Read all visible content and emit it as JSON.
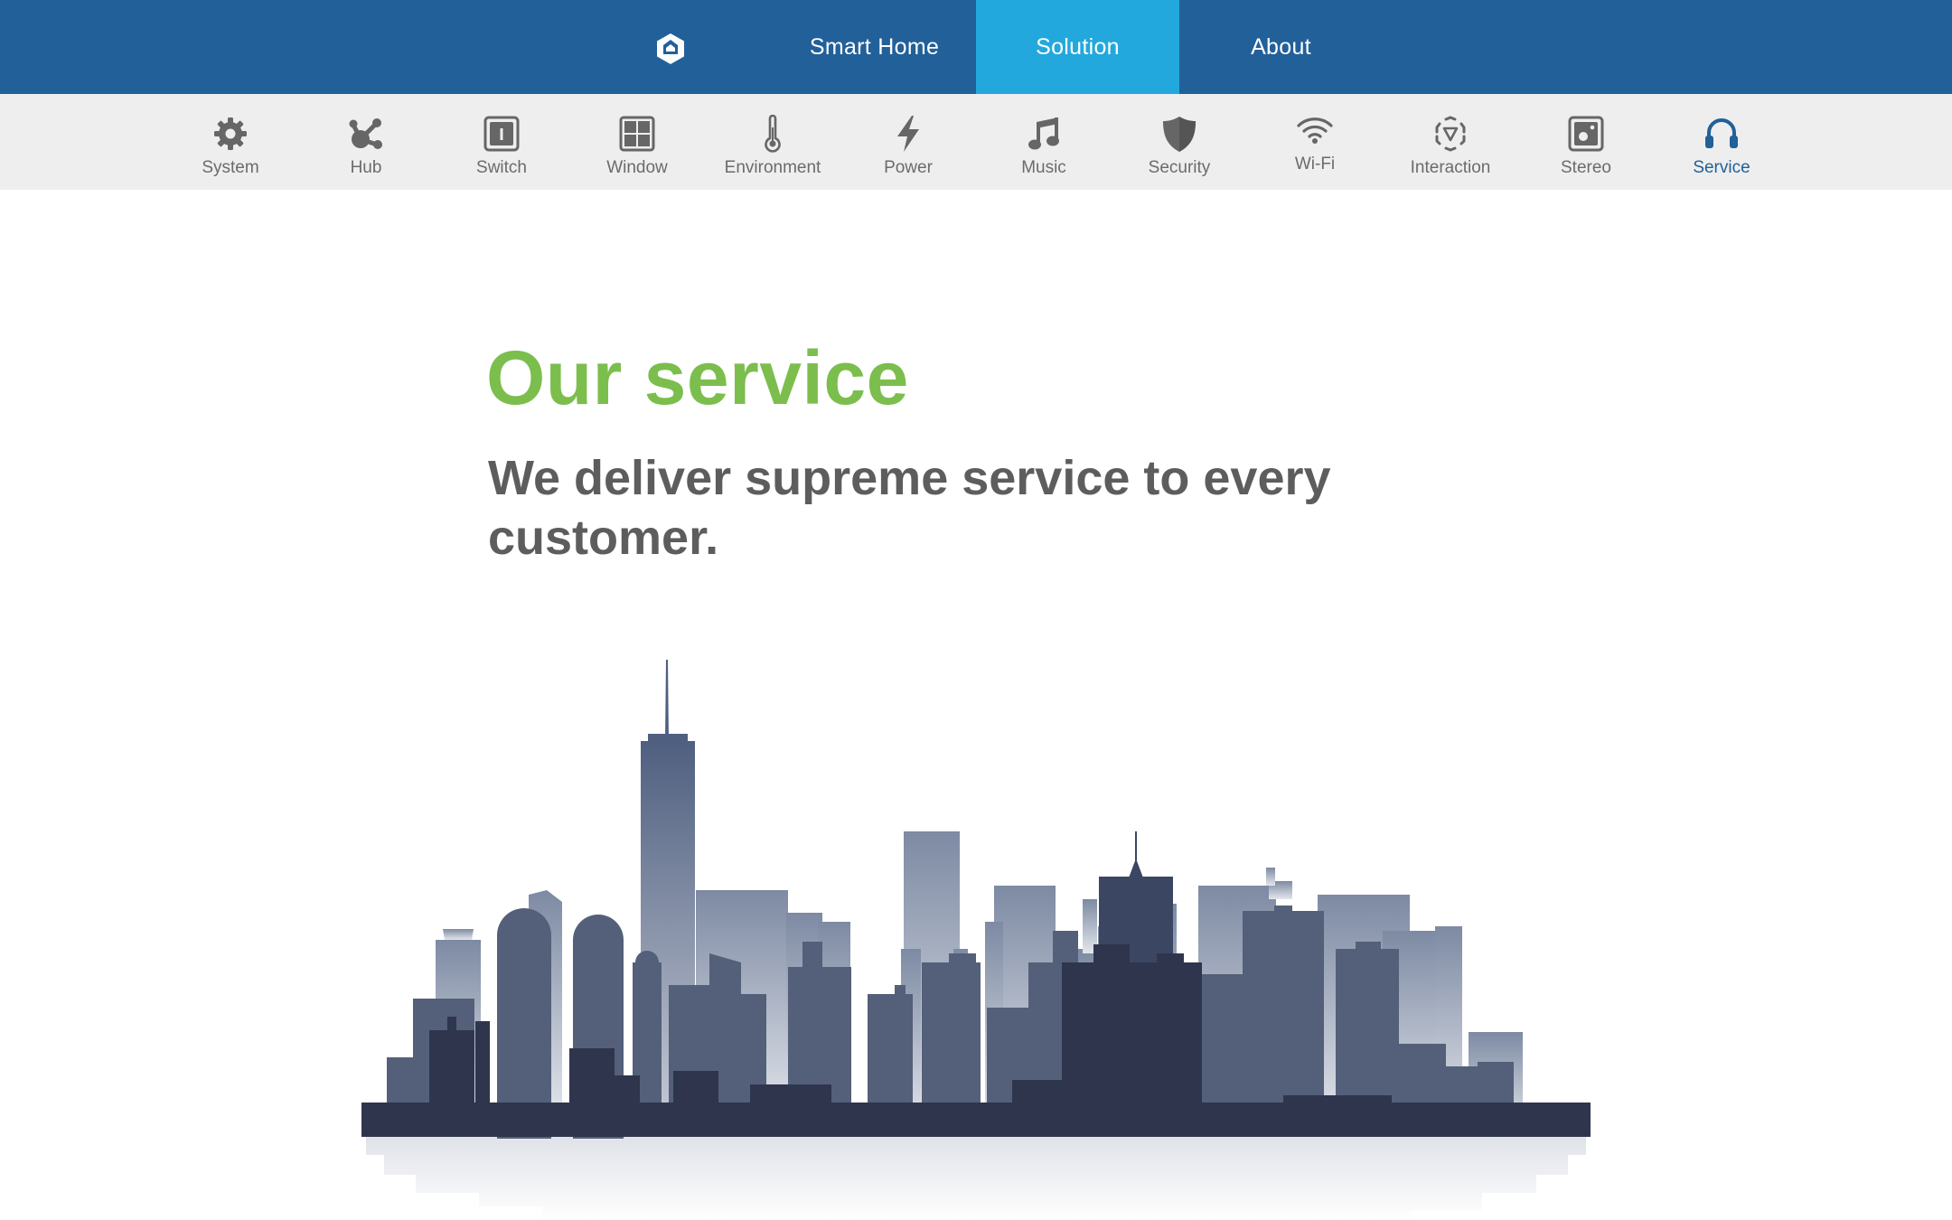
{
  "header": {
    "logo_icon": "hexagon-home-logo",
    "tabs": [
      {
        "label": "Smart Home",
        "active": false
      },
      {
        "label": "Solution",
        "active": true
      },
      {
        "label": "About",
        "active": false
      }
    ],
    "colors": {
      "bar": "#226099",
      "active_tab": "#23a8dd",
      "text": "#ffffff"
    }
  },
  "categories": {
    "items": [
      {
        "label": "System",
        "icon": "gear-icon"
      },
      {
        "label": "Hub",
        "icon": "hub-icon"
      },
      {
        "label": "Switch",
        "icon": "switch-icon"
      },
      {
        "label": "Window",
        "icon": "window-icon"
      },
      {
        "label": "Environment",
        "icon": "thermometer-icon"
      },
      {
        "label": "Power",
        "icon": "lightning-icon"
      },
      {
        "label": "Music",
        "icon": "music-note-icon"
      },
      {
        "label": "Security",
        "icon": "shield-icon"
      },
      {
        "label": "Wi-Fi",
        "icon": "wifi-icon"
      },
      {
        "label": "Interaction",
        "icon": "interaction-icon"
      },
      {
        "label": "Stereo",
        "icon": "stereo-icon"
      },
      {
        "label": "Service",
        "icon": "headset-icon"
      }
    ],
    "active": "Service",
    "colors": {
      "icon": "#666666",
      "label": "#6b6b6b",
      "active": "#226099",
      "background": "#eeeeee"
    }
  },
  "hero": {
    "title": "Our service",
    "subtitle": "We deliver supreme service to every customer.",
    "illustration": "city-skyline-illustration",
    "colors": {
      "title": "#7cbe4d",
      "subtitle": "#5d5d5d"
    }
  }
}
